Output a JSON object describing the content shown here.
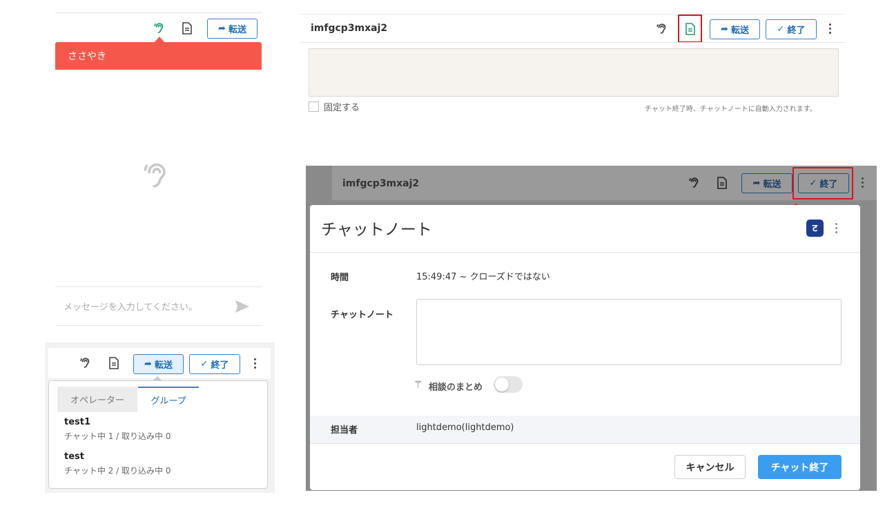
{
  "panel_whisper": {
    "forward_label": "転送",
    "tooltip_label": "ささやき",
    "input_placeholder": "メッセージを入力してください。"
  },
  "panel_note": {
    "chat_id": "imfgcp3mxaj2",
    "forward_label": "転送",
    "end_label": "終了",
    "pin_label": "固定する",
    "hint_text": "チャット終了時、チャットノートに自動入力されます。"
  },
  "panel_forward": {
    "forward_label": "転送",
    "end_label": "終了",
    "tabs": [
      "オペレーター",
      "グループ"
    ],
    "active_tab": "グループ",
    "groups": [
      {
        "name": "test1",
        "status": "チャット中 1 / 取り込み中 0"
      },
      {
        "name": "test",
        "status": "チャット中 2 / 取り込み中 0"
      }
    ]
  },
  "panel_modal": {
    "chat_id": "imfgcp3mxaj2",
    "forward_label": "転送",
    "end_label": "終了",
    "dialog_title": "チャットノート",
    "fields": {
      "time_label": "時間",
      "time_value": "15:49:47 ~ クローズドではない",
      "note_label": "チャットノート",
      "summary_label": "相談のまとめ",
      "summary_enabled": false,
      "assignee_label": "担当者",
      "assignee_value": "lightdemo(lightdemo)"
    },
    "cancel_label": "キャンセル",
    "confirm_label": "チャット終了",
    "colors": {
      "primary": "#3a9df0",
      "highlight": "#d9141c",
      "tooltip": "#f5584a"
    }
  }
}
